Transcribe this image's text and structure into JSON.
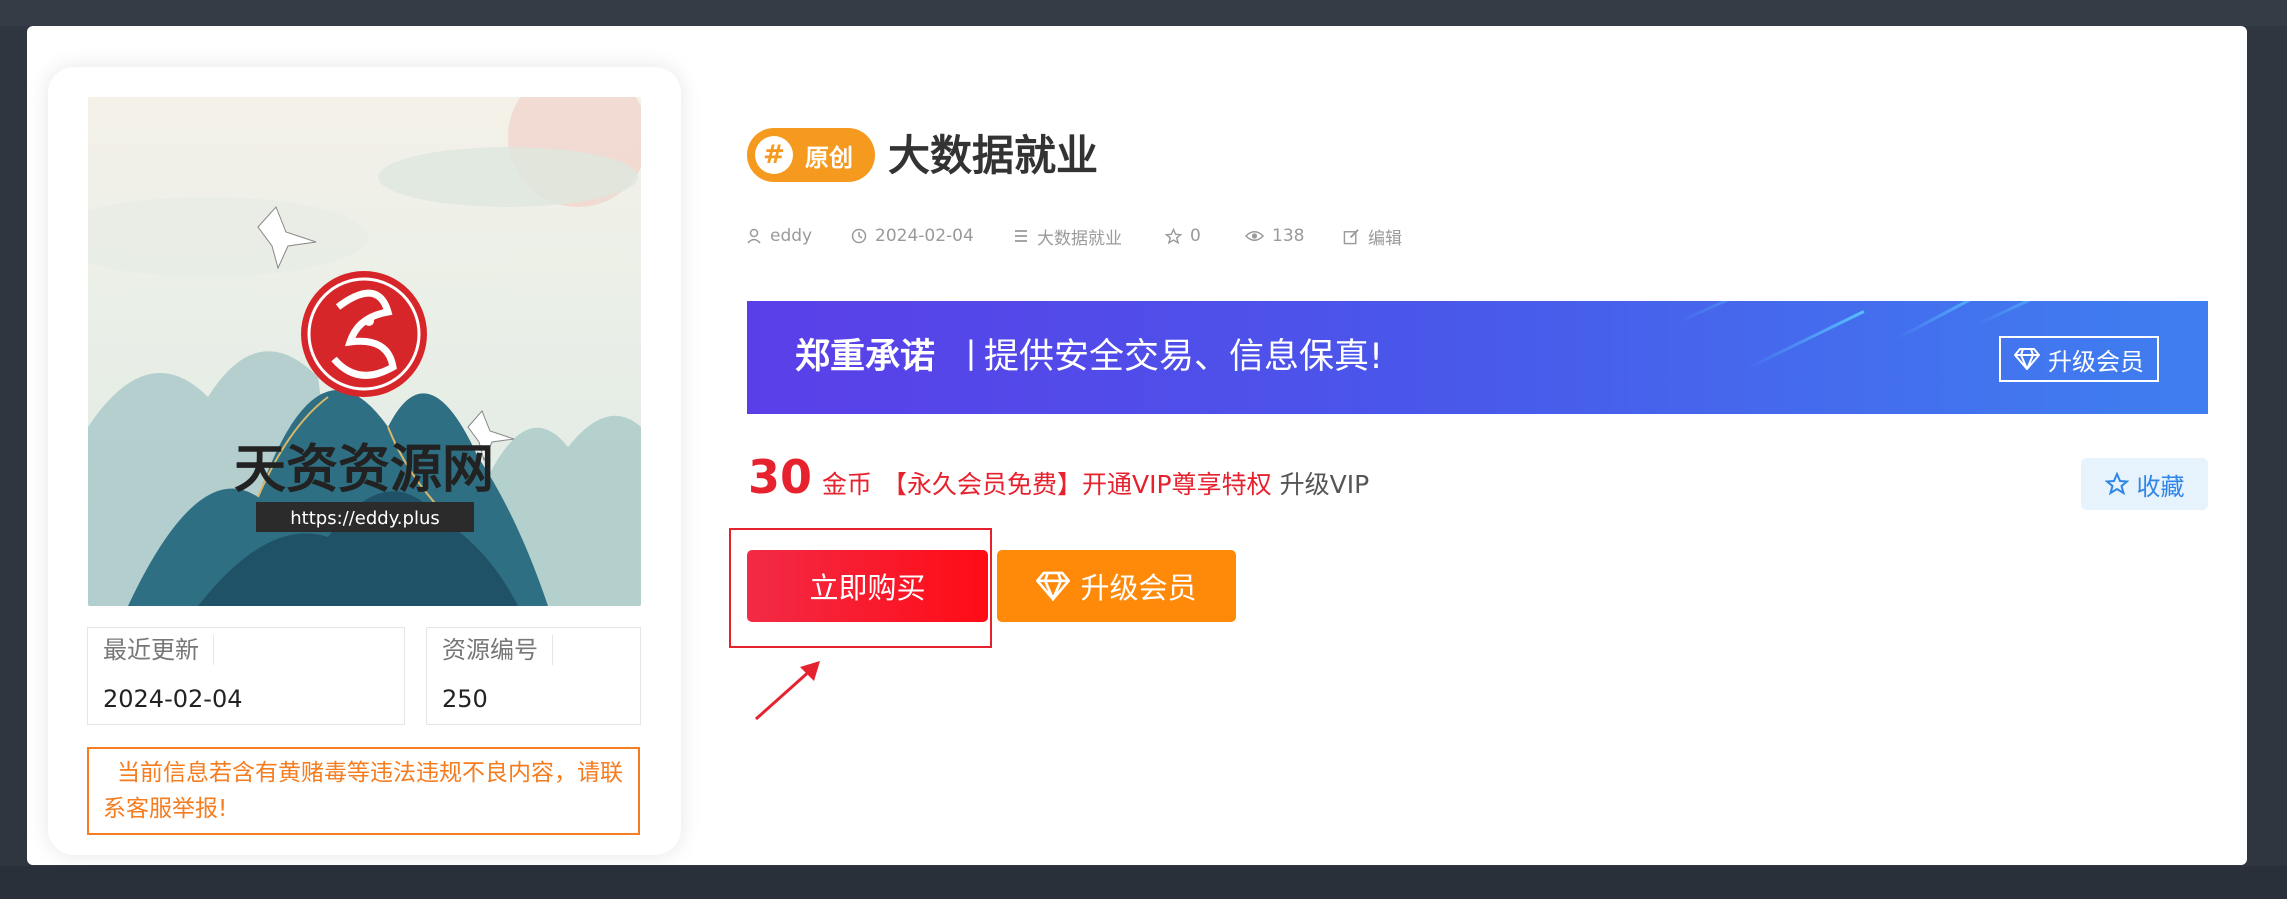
{
  "colors": {
    "accent_orange": "#f59a1f",
    "accent_red": "#e6222e",
    "banner_start": "#5a3fe8",
    "banner_end": "#3f7ff0",
    "fav_blue": "#2f86e6"
  },
  "cover": {
    "logo_title": "天资资源网",
    "logo_url": "https://eddy.plus"
  },
  "info": {
    "updated_label": "最近更新",
    "updated_value": "2024-02-04",
    "id_label": "资源编号",
    "id_value": "250"
  },
  "notice": "当前信息若含有黄赌毒等违法违规不良内容，请联系客服举报!",
  "post": {
    "badge": "原创",
    "title": "大数据就业"
  },
  "meta": {
    "author": "eddy",
    "date": "2024-02-04",
    "category": "大数据就业",
    "favorites": "0",
    "views": "138",
    "edit": "编辑",
    "icons": [
      "user-icon",
      "clock-icon",
      "list-icon",
      "star-icon",
      "eye-icon",
      "edit-icon"
    ]
  },
  "banner": {
    "strong": "郑重承诺",
    "separator": "丨",
    "text": "提供安全交易、信息保真!",
    "button": "升级会员"
  },
  "price": {
    "amount": "30",
    "unit": "金币",
    "offer": "【永久会员免费】开通VIP尊享特权",
    "upgrade": "升级VIP"
  },
  "actions": {
    "favorite": "收藏",
    "buy": "立即购买",
    "upgrade": "升级会员"
  }
}
